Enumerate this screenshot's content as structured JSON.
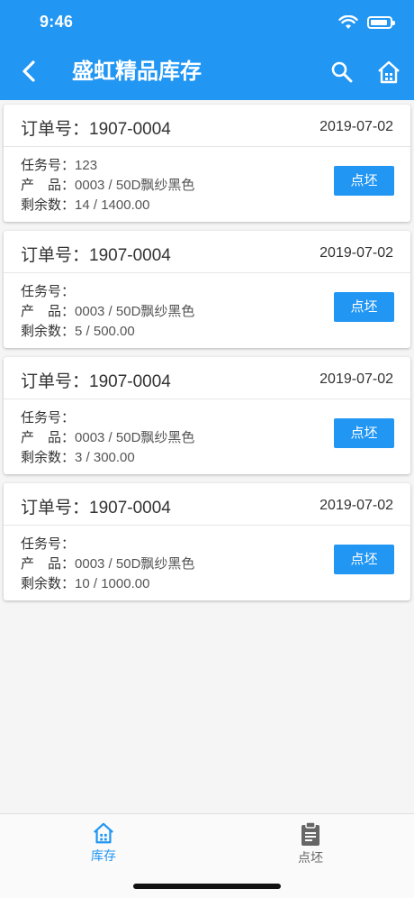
{
  "status_bar": {
    "time": "9:46"
  },
  "app_bar": {
    "title": "盛虹精品库存"
  },
  "labels": {
    "order_prefix": "订单号：",
    "task": "任务号：",
    "product": "产　品：",
    "remaining": "剩余数："
  },
  "cards": [
    {
      "order_no": "1907-0004",
      "date": "2019-07-02",
      "task_no": "123",
      "product": "0003 / 50D飘纱黑色",
      "remaining": "14 / 1400.00",
      "action_label": "点坯"
    },
    {
      "order_no": "1907-0004",
      "date": "2019-07-02",
      "task_no": "",
      "product": "0003 / 50D飘纱黑色",
      "remaining": "5 / 500.00",
      "action_label": "点坯"
    },
    {
      "order_no": "1907-0004",
      "date": "2019-07-02",
      "task_no": "",
      "product": "0003 / 50D飘纱黑色",
      "remaining": "3 / 300.00",
      "action_label": "点坯"
    },
    {
      "order_no": "1907-0004",
      "date": "2019-07-02",
      "task_no": "",
      "product": "0003 / 50D飘纱黑色",
      "remaining": "10 / 1000.00",
      "action_label": "点坯"
    }
  ],
  "bottom_nav": {
    "items": [
      {
        "label": "库存",
        "icon": "home-icon",
        "active": true
      },
      {
        "label": "点坯",
        "icon": "clipboard-icon",
        "active": false
      }
    ]
  },
  "colors": {
    "primary": "#2196f3",
    "background": "#f5f5f5",
    "inactive": "#666666"
  }
}
